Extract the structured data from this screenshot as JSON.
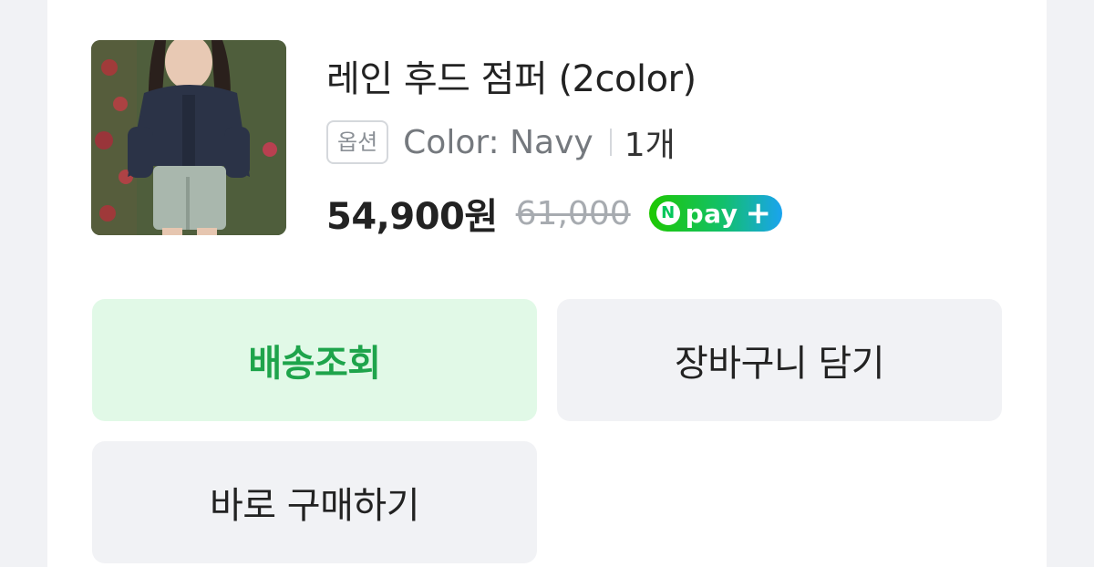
{
  "product": {
    "name": "레인 후드 점퍼 (2color)",
    "option_badge": "옵션",
    "option_value": "Color: Navy",
    "quantity": "1개",
    "price": "54,900원",
    "original_price": "61,000",
    "payment_badge": {
      "icon": "naver-n-icon",
      "n_letter": "N",
      "label": "pay",
      "plus": "+"
    }
  },
  "actions": {
    "delivery_label": "배송조회",
    "cart_label": "장바구니 담기",
    "buy_label": "바로 구매하기"
  },
  "colors": {
    "delivery_bg": "#e1f9e7",
    "delivery_text": "#1ea44b",
    "neutral_button_bg": "#f1f2f5",
    "npay_green": "#03c75a"
  }
}
